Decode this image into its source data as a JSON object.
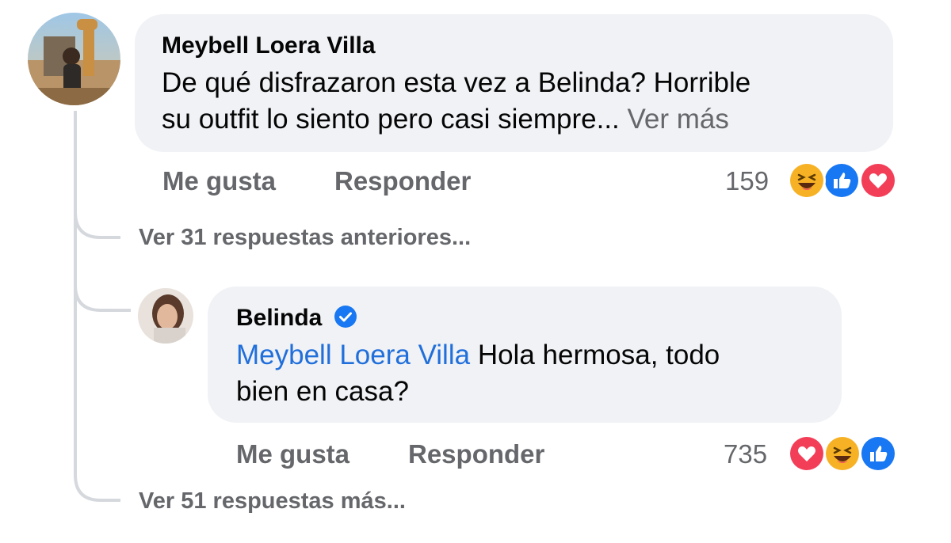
{
  "comment": {
    "author": "Meybell Loera Villa",
    "text": "De qué disfrazaron esta vez a Belinda? Horrible",
    "text_line2": "su outfit lo siento pero casi siempre...",
    "see_more": "Ver más",
    "like_label": "Me gusta",
    "reply_label": "Responder",
    "reaction_count": "159",
    "reactions": [
      "haha-icon",
      "like-icon",
      "love-icon"
    ]
  },
  "previous_replies_label": "Ver 31 respuestas anteriores...",
  "reply": {
    "author": "Belinda",
    "verified": true,
    "mention": "Meybell Loera Villa",
    "text": "Hola hermosa, todo",
    "text_line2": "bien en casa?",
    "like_label": "Me gusta",
    "reply_label": "Responder",
    "reaction_count": "735",
    "reactions": [
      "love-icon",
      "haha-icon",
      "like-icon"
    ]
  },
  "more_replies_label": "Ver 51 respuestas más...",
  "colors": {
    "bubble": "#f0f2f5",
    "secondary_text": "#65676b",
    "mention": "#216fdb",
    "like_blue": "#1877f2",
    "love_red": "#f33e58",
    "haha_yellow": "#f7b125"
  }
}
